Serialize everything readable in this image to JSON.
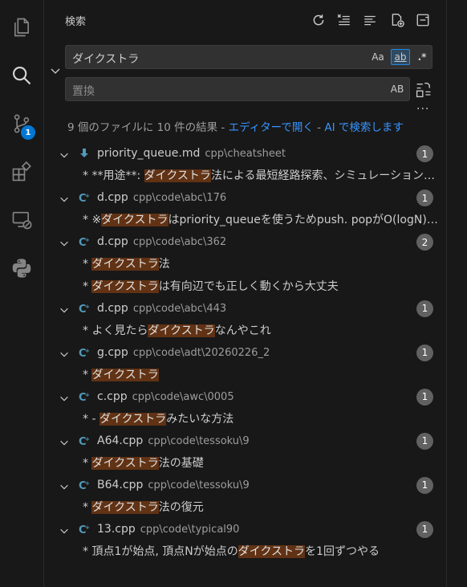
{
  "activity_bar": {
    "items": [
      {
        "name": "explorer-icon"
      },
      {
        "name": "search-icon"
      },
      {
        "name": "source-control-icon",
        "badge": "1"
      },
      {
        "name": "extensions-icon"
      },
      {
        "name": "remote-explorer-icon"
      },
      {
        "name": "python-icon"
      }
    ]
  },
  "header": {
    "title": "検索"
  },
  "search": {
    "value": "ダイクストラ",
    "case_label": "Aa",
    "word_label": "ab",
    "regex_label": ".*"
  },
  "replace": {
    "placeholder": "置換",
    "preserve_case_label": "AB"
  },
  "summary": {
    "text": "9 個のファイルに 10 件の結果 - ",
    "open_editor": "エディターで開く",
    "sep": " - ",
    "ai_search": "AI で検索します"
  },
  "results": [
    {
      "file": "priority_queue.md",
      "path": "cpp\\cheatsheet",
      "count": "1",
      "icon": "markdown-icon",
      "matches": [
        {
          "pre": "* **用途**: ",
          "hit": "ダイクストラ",
          "post": "法による最短経路探索、シミュレーション問題..."
        }
      ]
    },
    {
      "file": "d.cpp",
      "path": "cpp\\code\\abc\\176",
      "count": "1",
      "icon": "cpp-icon",
      "matches": [
        {
          "pre": "* ※",
          "hit": "ダイクストラ",
          "post": "はpriority_queueを使うためpush. popがO(logN)で..."
        }
      ]
    },
    {
      "file": "d.cpp",
      "path": "cpp\\code\\abc\\362",
      "count": "2",
      "icon": "cpp-icon",
      "matches": [
        {
          "pre": "* ",
          "hit": "ダイクストラ",
          "post": "法"
        },
        {
          "pre": "* ",
          "hit": "ダイクストラ",
          "post": "は有向辺でも正しく動くから大丈夫"
        }
      ]
    },
    {
      "file": "d.cpp",
      "path": "cpp\\code\\abc\\443",
      "count": "1",
      "icon": "cpp-icon",
      "matches": [
        {
          "pre": "* よく見たら",
          "hit": "ダイクストラ",
          "post": "なんやこれ"
        }
      ]
    },
    {
      "file": "g.cpp",
      "path": "cpp\\code\\adt\\20260226_2",
      "count": "1",
      "icon": "cpp-icon",
      "matches": [
        {
          "pre": "* ",
          "hit": "ダイクストラ",
          "post": ""
        }
      ]
    },
    {
      "file": "c.cpp",
      "path": "cpp\\code\\awc\\0005",
      "count": "1",
      "icon": "cpp-icon",
      "matches": [
        {
          "pre": "* - ",
          "hit": "ダイクストラ",
          "post": "みたいな方法"
        }
      ]
    },
    {
      "file": "A64.cpp",
      "path": "cpp\\code\\tessoku\\9",
      "count": "1",
      "icon": "cpp-icon",
      "matches": [
        {
          "pre": "* ",
          "hit": "ダイクストラ",
          "post": "法の基礎"
        }
      ]
    },
    {
      "file": "B64.cpp",
      "path": "cpp\\code\\tessoku\\9",
      "count": "1",
      "icon": "cpp-icon",
      "matches": [
        {
          "pre": "* ",
          "hit": "ダイクストラ",
          "post": "法の復元"
        }
      ]
    },
    {
      "file": "13.cpp",
      "path": "cpp\\code\\typical90",
      "count": "1",
      "icon": "cpp-icon",
      "matches": [
        {
          "pre": "* 頂点1が始点, 頂点Nが始点の",
          "hit": "ダイクストラ",
          "post": "を1回ずつやる"
        }
      ]
    }
  ],
  "colors": {
    "highlight": "#613214",
    "badge": "#0078d4",
    "link": "#3794ff",
    "cpp_icon": "#519aba"
  }
}
